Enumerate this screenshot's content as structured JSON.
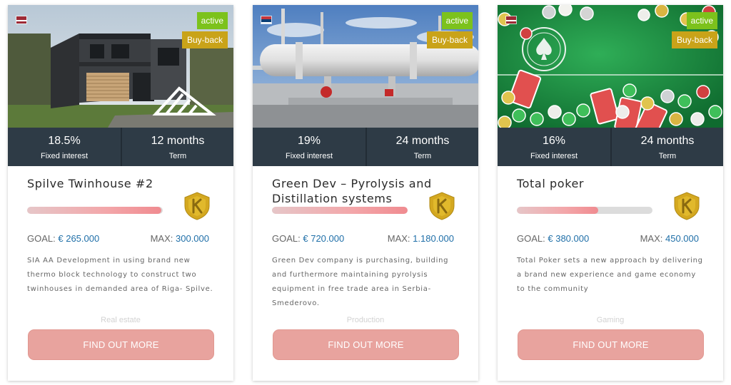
{
  "projects": [
    {
      "flag_icon": "latvia-flag-icon",
      "status": "active",
      "buyback": "Buy-back",
      "interest_value": "18.5%",
      "interest_label": "Fixed interest",
      "term_value": "12 months",
      "term_label": "Term",
      "title": "Spilve Twinhouse #2",
      "progress": 0.99,
      "goal_label": "GOAL:",
      "goal_value": "€ 265.000",
      "max_label": "MAX:",
      "max_value": "300.000",
      "description": "SIA AA Development in using brand new thermo block technology to construct two twinhouses in demanded area of Riga- Spilve.",
      "category": "Real estate",
      "cta": "FIND OUT MORE"
    },
    {
      "flag_icon": "serbia-flag-icon",
      "status": "active",
      "buyback": "Buy-back",
      "interest_value": "19%",
      "interest_label": "Fixed interest",
      "term_value": "24 months",
      "term_label": "Term",
      "title": "Green Dev – Pyrolysis and Distillation systems",
      "progress": 1.0,
      "goal_label": "GOAL:",
      "goal_value": "€ 720.000",
      "max_label": "MAX:",
      "max_value": "1.180.000",
      "description": "Green Dev company is purchasing, building and furthermore maintaining pyrolysis equipment in free trade area in Serbia- Smederovo.",
      "category": "Production",
      "cta": "FIND OUT MORE"
    },
    {
      "flag_icon": "latvia-flag-icon",
      "status": "active",
      "buyback": "Buy-back",
      "interest_value": "16%",
      "interest_label": "Fixed interest",
      "term_value": "24 months",
      "term_label": "Term",
      "title": "Total poker",
      "progress": 0.6,
      "goal_label": "GOAL:",
      "goal_value": "€ 380.000",
      "max_label": "MAX:",
      "max_value": "450.000",
      "description": "Total Poker sets a new approach by delivering a brand new experience and game economy to the community",
      "category": "Gaming",
      "cta": "FIND OUT MORE"
    }
  ],
  "colors": {
    "active_badge": "#7cc21c",
    "buyback_badge": "#c9a319",
    "stats_bar": "#2e3b46",
    "accent_value": "#1f6fa8",
    "cta": "#e8a39e"
  }
}
